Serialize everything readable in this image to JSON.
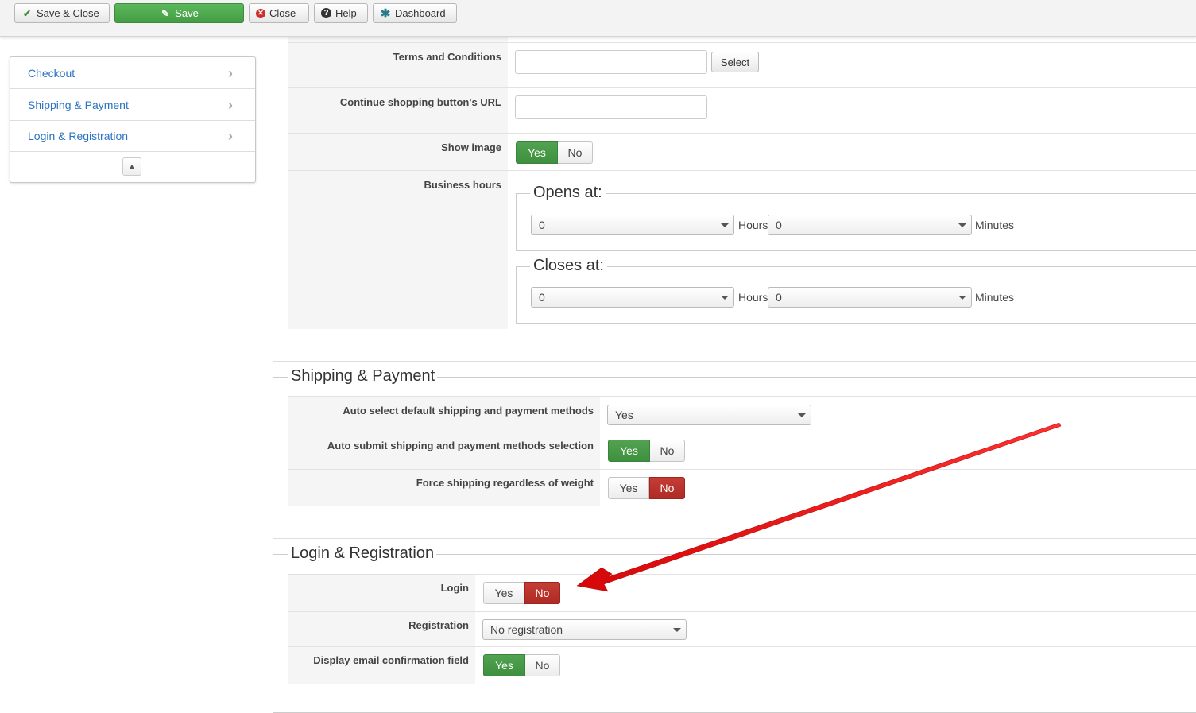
{
  "toolbar": {
    "save_close": "Save & Close",
    "save": "Save",
    "close": "Close",
    "help": "Help",
    "dashboard": "Dashboard"
  },
  "sidebar": {
    "items": [
      {
        "label": "Checkout"
      },
      {
        "label": "Shipping & Payment"
      },
      {
        "label": "Login & Registration"
      }
    ]
  },
  "checkout": {
    "terms_label": "Terms and Conditions",
    "terms_select": "Select",
    "continue_url_label": "Continue shopping button's URL",
    "show_image_label": "Show image",
    "show_image": {
      "yes": "Yes",
      "no": "No",
      "value": "Yes"
    },
    "business_hours_label": "Business hours",
    "opens_at": {
      "title": "Opens at:",
      "hours_value": "0",
      "hours_unit": "Hours",
      "minutes_value": "0",
      "minutes_unit": "Minutes"
    },
    "closes_at": {
      "title": "Closes at:",
      "hours_value": "0",
      "hours_unit": "Hours",
      "minutes_value": "0",
      "minutes_unit": "Minutes"
    }
  },
  "shipping": {
    "title": "Shipping & Payment",
    "auto_select_label": "Auto select default shipping and payment methods",
    "auto_select_value": "Yes",
    "auto_submit_label": "Auto submit shipping and payment methods selection",
    "auto_submit": {
      "yes": "Yes",
      "no": "No",
      "value": "Yes"
    },
    "force_label": "Force shipping regardless of weight",
    "force": {
      "yes": "Yes",
      "no": "No",
      "value": "No"
    }
  },
  "login": {
    "title": "Login & Registration",
    "login_label": "Login",
    "login": {
      "yes": "Yes",
      "no": "No",
      "value": "No"
    },
    "registration_label": "Registration",
    "registration_value": "No registration",
    "email_confirm_label": "Display email confirmation field",
    "email_confirm": {
      "yes": "Yes",
      "no": "No",
      "value": "Yes"
    }
  },
  "colors": {
    "link": "#2a73c2",
    "yes_active": "#46a046",
    "no_active": "#b7302a",
    "annotation_arrow": "#e01010"
  },
  "icons": [
    "check-icon",
    "edit-icon",
    "close-circle-icon",
    "help-icon",
    "dashboard-icon",
    "chevron-right-icon",
    "scroll-up-icon"
  ]
}
